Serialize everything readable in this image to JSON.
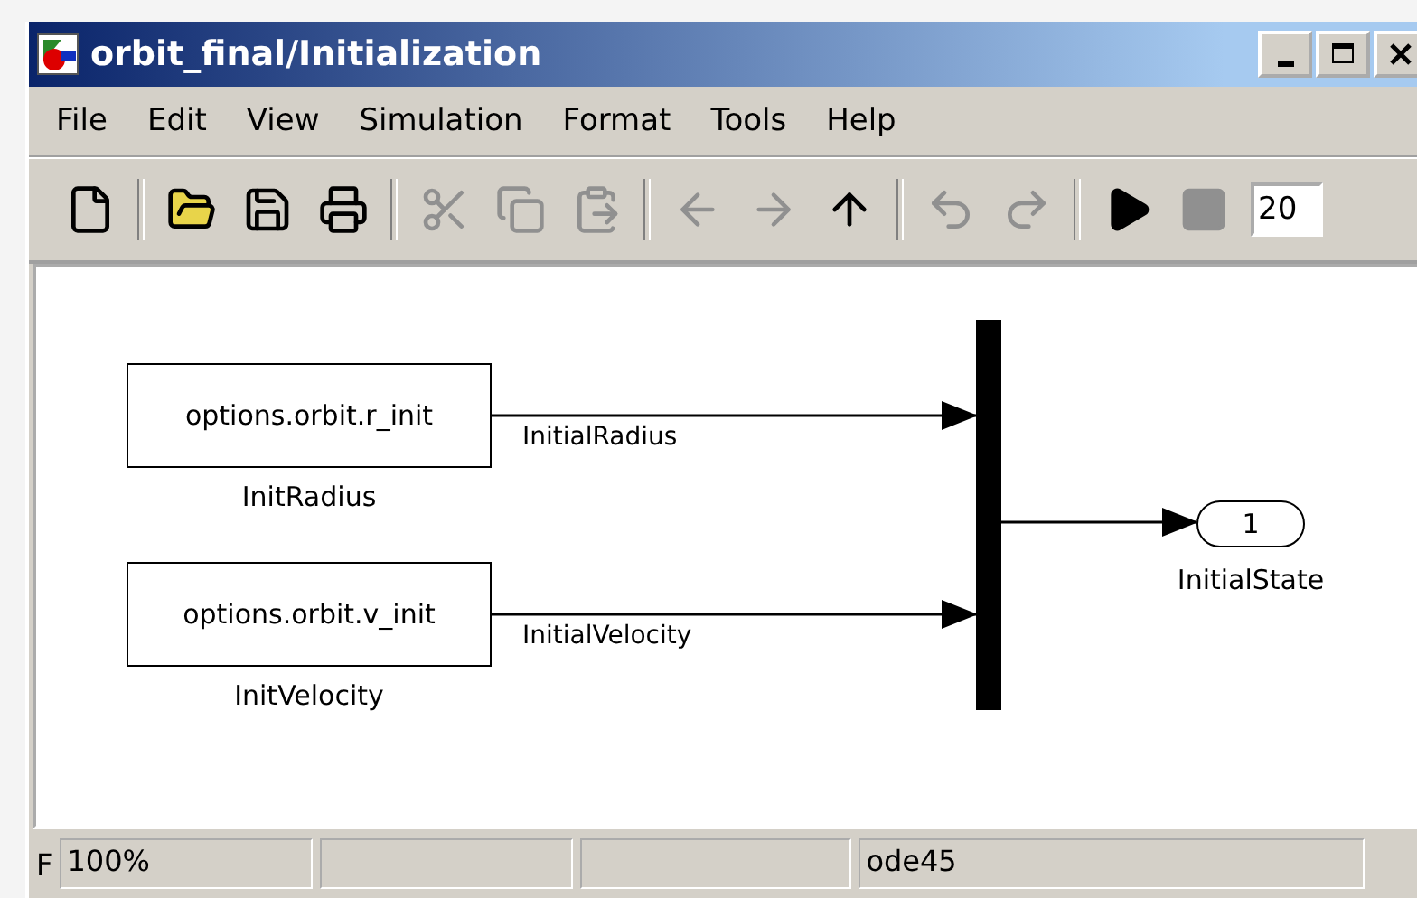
{
  "window": {
    "title": "orbit_final/Initialization"
  },
  "menu": [
    {
      "label": "File"
    },
    {
      "label": "Edit"
    },
    {
      "label": "View"
    },
    {
      "label": "Simulation"
    },
    {
      "label": "Format"
    },
    {
      "label": "Tools"
    },
    {
      "label": "Help"
    }
  ],
  "toolbar": [
    {
      "kind": "new",
      "disabled": false
    },
    {
      "kind": "separator"
    },
    {
      "kind": "open",
      "disabled": false
    },
    {
      "kind": "save",
      "disabled": false
    },
    {
      "kind": "print",
      "disabled": false
    },
    {
      "kind": "separator"
    },
    {
      "kind": "cut",
      "disabled": true
    },
    {
      "kind": "copy",
      "disabled": true
    },
    {
      "kind": "paste",
      "disabled": true
    },
    {
      "kind": "separator"
    },
    {
      "kind": "back",
      "disabled": true
    },
    {
      "kind": "forward",
      "disabled": true
    },
    {
      "kind": "up",
      "disabled": false
    },
    {
      "kind": "separator"
    },
    {
      "kind": "undo",
      "disabled": true
    },
    {
      "kind": "redo",
      "disabled": true
    },
    {
      "kind": "separator"
    },
    {
      "kind": "play",
      "disabled": false
    },
    {
      "kind": "stop",
      "disabled": true
    },
    {
      "kind": "field",
      "value": "20"
    }
  ],
  "diagram": {
    "blocks": [
      {
        "kind": "constant",
        "value": "options.orbit.r_init",
        "name": "InitRadius"
      },
      {
        "kind": "constant",
        "value": "options.orbit.v_init",
        "name": "InitVelocity"
      }
    ],
    "signals": [
      {
        "label": "InitialRadius"
      },
      {
        "label": "InitialVelocity"
      }
    ],
    "mux": {
      "kind": "mux"
    },
    "outport": {
      "number": "1",
      "name": "InitialState"
    }
  },
  "status_bar": [
    {
      "kind": "text",
      "text": "F"
    },
    {
      "kind": "cell",
      "text": "100%"
    },
    {
      "kind": "cell"
    },
    {
      "kind": "cell"
    },
    {
      "kind": "cell",
      "text": "ode45"
    }
  ]
}
